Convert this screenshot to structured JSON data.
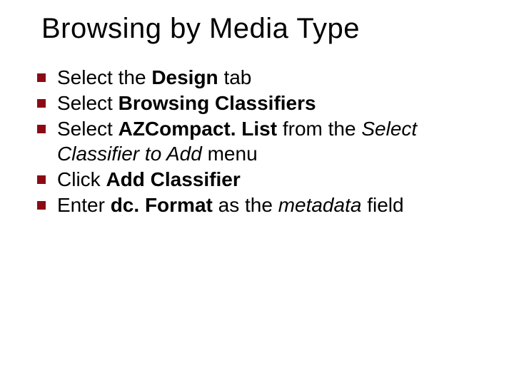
{
  "title": "Browsing by Media Type",
  "items": [
    {
      "runs": [
        {
          "text": "Select the "
        },
        {
          "text": "Design",
          "bold": true
        },
        {
          "text": " tab"
        }
      ]
    },
    {
      "runs": [
        {
          "text": "Select "
        },
        {
          "text": "Browsing Classifiers",
          "bold": true
        }
      ]
    },
    {
      "runs": [
        {
          "text": "Select "
        },
        {
          "text": "AZCompact. List",
          "bold": true
        },
        {
          "text": " from the "
        },
        {
          "text": "Select Classifier to Add",
          "italic": true
        },
        {
          "text": " menu"
        }
      ]
    },
    {
      "runs": [
        {
          "text": "Click "
        },
        {
          "text": "Add Classifier",
          "bold": true
        }
      ]
    },
    {
      "runs": [
        {
          "text": "Enter "
        },
        {
          "text": "dc. Format",
          "bold": true
        },
        {
          "text": " as the "
        },
        {
          "text": "metadata",
          "italic": true
        },
        {
          "text": " field"
        }
      ]
    }
  ]
}
